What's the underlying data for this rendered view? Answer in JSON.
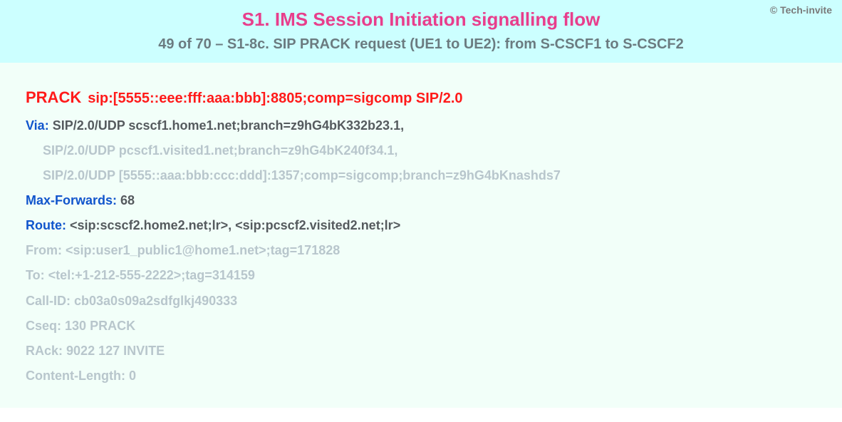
{
  "copyright": "© Tech-invite",
  "header": {
    "title": "S1. IMS Session Initiation signalling flow",
    "subtitle": "49 of 70 – S1-8c. SIP PRACK request (UE1 to UE2): from S-CSCF1 to S-CSCF2"
  },
  "sip": {
    "method": "PRACK",
    "request_uri": "sip:[5555::eee:fff:aaa:bbb]:8805;comp=sigcomp SIP/2.0",
    "via_label": "Via:",
    "via1": "SIP/2.0/UDP scscf1.home1.net;branch=z9hG4bK332b23.1,",
    "via2": "SIP/2.0/UDP pcscf1.visited1.net;branch=z9hG4bK240f34.1,",
    "via3": "SIP/2.0/UDP [5555::aaa:bbb:ccc:ddd]:1357;comp=sigcomp;branch=z9hG4bKnashds7",
    "maxf_label": "Max-Forwards:",
    "maxf_value": "68",
    "route_label": "Route:",
    "route_value": "<sip:scscf2.home2.net;lr>, <sip:pcscf2.visited2.net;lr>",
    "from_label": "From:",
    "from_value": "<sip:user1_public1@home1.net>;tag=171828",
    "to_label": "To:",
    "to_value": "<tel:+1-212-555-2222>;tag=314159",
    "callid_label": "Call-ID:",
    "callid_value": "cb03a0s09a2sdfglkj490333",
    "cseq_label": "Cseq:",
    "cseq_value": "130 PRACK",
    "rack_label": "RAck:",
    "rack_value": "9022 127 INVITE",
    "clen_label": "Content-Length:",
    "clen_value": "0"
  }
}
